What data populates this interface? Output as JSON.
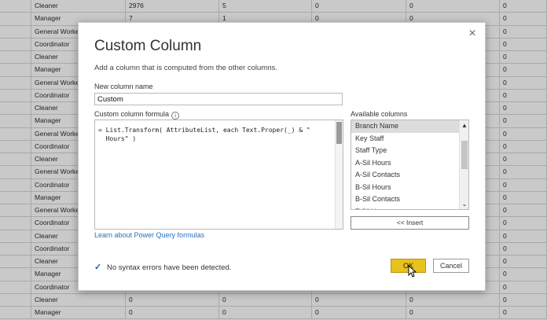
{
  "grid": {
    "rows": [
      [
        "Cleaner",
        "2976",
        "5",
        "0",
        "0",
        "0"
      ],
      [
        "Manager",
        "7",
        "1",
        "0",
        "0",
        "0"
      ],
      [
        "General Worker",
        "",
        "",
        "",
        "",
        "0"
      ],
      [
        "Coordinator",
        "",
        "",
        "",
        "",
        "0"
      ],
      [
        "Cleaner",
        "",
        "",
        "",
        "",
        "0"
      ],
      [
        "Manager",
        "",
        "",
        "",
        "",
        "0"
      ],
      [
        "General Worker",
        "",
        "",
        "",
        "",
        "0"
      ],
      [
        "Coordinator",
        "",
        "",
        "",
        "",
        "0"
      ],
      [
        "Cleaner",
        "",
        "",
        "",
        "",
        "0"
      ],
      [
        "Manager",
        "",
        "",
        "",
        "",
        "0"
      ],
      [
        "General Worker",
        "",
        "",
        "",
        "",
        "0"
      ],
      [
        "Coordinator",
        "",
        "",
        "",
        "",
        "0"
      ],
      [
        "Cleaner",
        "",
        "",
        "",
        "",
        "0"
      ],
      [
        "General Worker",
        "",
        "",
        "",
        "",
        "0"
      ],
      [
        "Coordinator",
        "",
        "",
        "",
        "",
        "0"
      ],
      [
        "Manager",
        "",
        "",
        "",
        "",
        "0"
      ],
      [
        "General Worker",
        "",
        "",
        "",
        "",
        "0"
      ],
      [
        "Coordinator",
        "",
        "",
        "",
        "",
        "0"
      ],
      [
        "Cleaner",
        "",
        "",
        "",
        "",
        "0"
      ],
      [
        "Coordinator",
        "",
        "",
        "",
        "",
        "0"
      ],
      [
        "Cleaner",
        "",
        "",
        "",
        "",
        "0"
      ],
      [
        "Manager",
        "",
        "",
        "",
        "",
        "0"
      ],
      [
        "Coordinator",
        "",
        "",
        "",
        "",
        "0"
      ],
      [
        "Cleaner",
        "0",
        "0",
        "0",
        "0",
        "0"
      ],
      [
        "Manager",
        "0",
        "0",
        "0",
        "0",
        "0"
      ]
    ]
  },
  "dialog": {
    "title": "Custom Column",
    "close_glyph": "×",
    "description": "Add a column that is computed from the other columns.",
    "name_label": "New column name",
    "name_value": "Custom",
    "formula_label": "Custom column formula",
    "info_glyph": "i",
    "formula_text": "= List.Transform( AttributeList, each Text.Proper(_) & \"\n  Hours\" )",
    "learn_link": "Learn about Power Query formulas",
    "available_label": "Available columns",
    "available_columns": [
      "Branch Name",
      "Key Staff",
      "Staff Type",
      "A-Sil Hours",
      "A-Sil Contacts",
      "B-Sil Hours",
      "B-Sil Contacts",
      "T-Sil Hours"
    ],
    "scroll_up_glyph": "▲",
    "scroll_down_glyph": "⌄",
    "insert_label": "<< Insert",
    "status_check_glyph": "✓",
    "status_text": "No syntax errors have been detected.",
    "ok_label": "OK",
    "cancel_label": "Cancel",
    "accent_color": "#e8c11b"
  }
}
